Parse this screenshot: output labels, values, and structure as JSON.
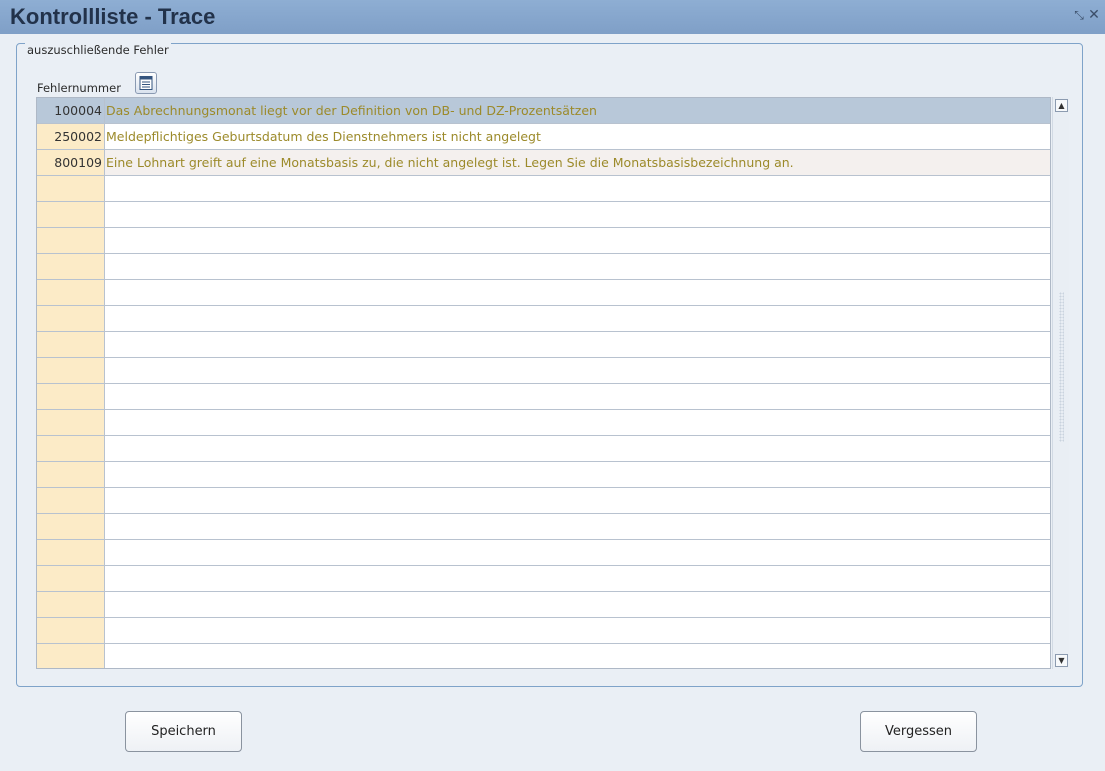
{
  "window": {
    "title": "Kontrollliste - Trace",
    "restore_glyph": "⤡",
    "close_glyph": "✕"
  },
  "group": {
    "legend": "auszuschließende Fehler",
    "column_label": "Fehlernummer",
    "list_icon": "list-icon"
  },
  "rows": [
    {
      "number": "100004",
      "text": "Das Abrechnungsmonat liegt vor der Definition von DB- und DZ-Prozentsätzen"
    },
    {
      "number": "250002",
      "text": "Meldepflichtiges Geburtsdatum des Dienstnehmers ist nicht angelegt"
    },
    {
      "number": "800109",
      "text": "Eine Lohnart greift auf eine Monatsbasis zu, die nicht angelegt ist. Legen Sie die Monatsbasisbezeichnung an."
    }
  ],
  "empty_row_count": 19,
  "buttons": {
    "save": "Speichern",
    "forget": "Vergessen"
  },
  "colors": {
    "titlebar": "#8eaed3",
    "number_column": "#fcebc7",
    "selected_row": "#b8c8d9",
    "error_text": "#9c8a2a"
  }
}
